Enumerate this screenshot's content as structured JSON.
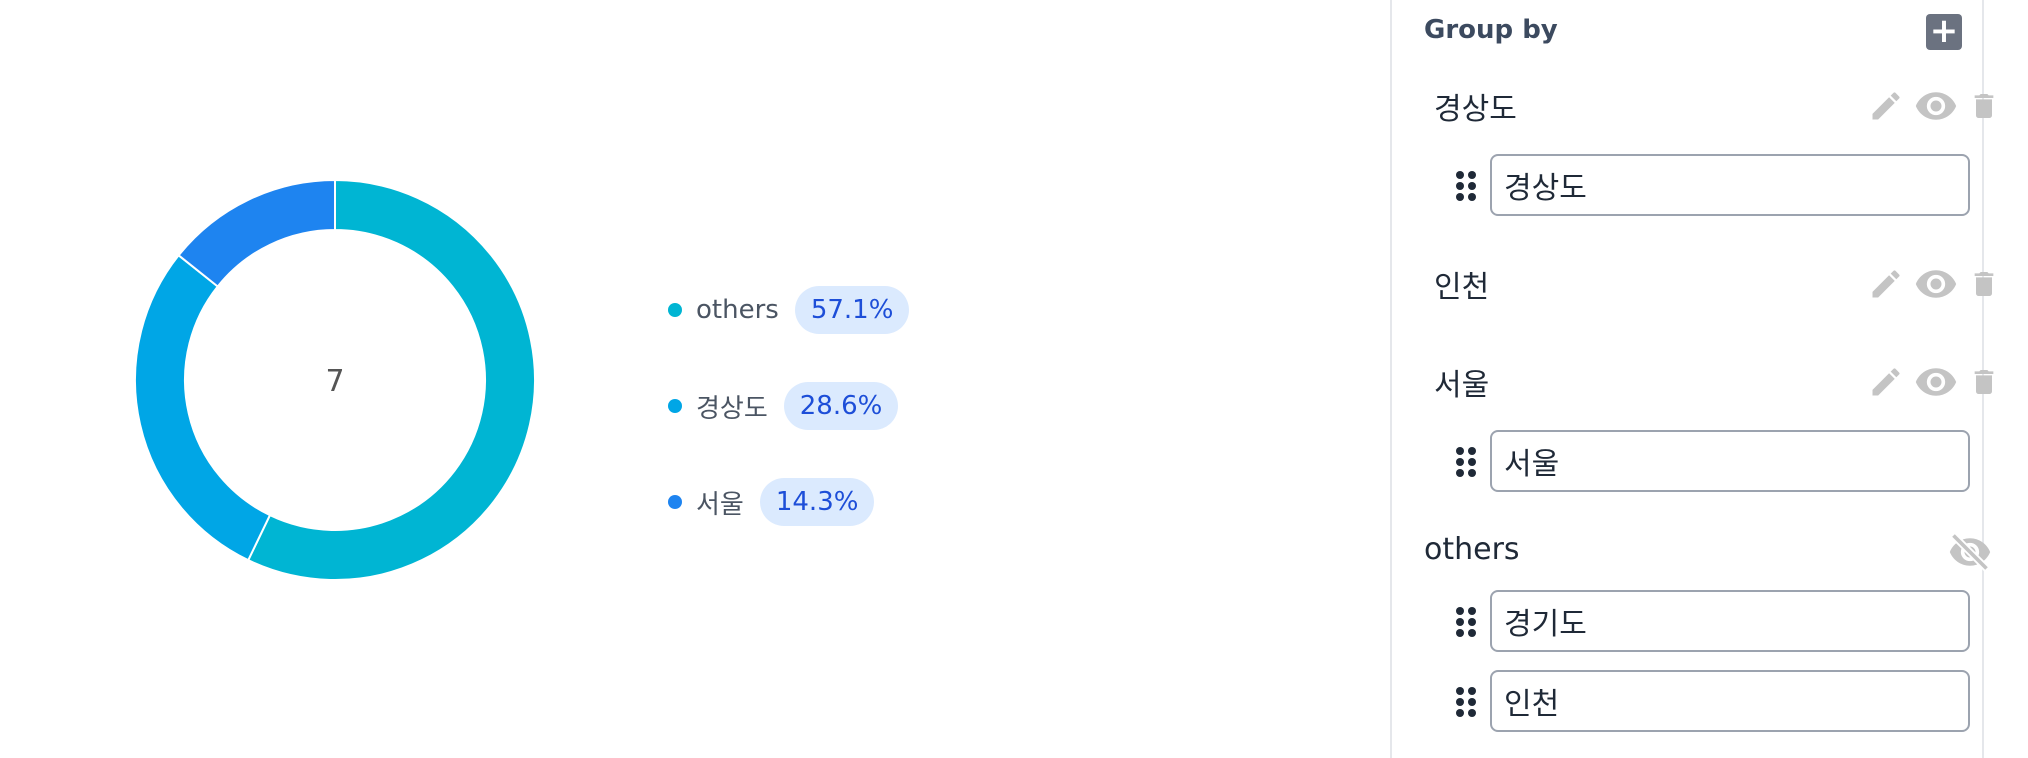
{
  "chart_data": {
    "type": "pie",
    "center_label": "7",
    "slices": [
      {
        "label": "others",
        "percent_label": "57.1%",
        "value": 4,
        "color": "#00B5D3"
      },
      {
        "label": "경상도",
        "percent_label": "28.6%",
        "value": 2,
        "color": "#00A6E6"
      },
      {
        "label": "서울",
        "percent_label": "14.3%",
        "value": 1,
        "color": "#1E84F0"
      }
    ]
  },
  "panel": {
    "title": "Group by",
    "add_icon": "plus-icon",
    "groups": [
      {
        "name": "경상도",
        "values": [
          "경상도"
        ],
        "hidden": false
      },
      {
        "name": "인천",
        "values": [],
        "hidden": false
      },
      {
        "name": "서울",
        "values": [
          "서울"
        ],
        "hidden": false
      },
      {
        "name": "others",
        "values": [
          "경기도",
          "인천"
        ],
        "hidden": true
      }
    ]
  }
}
